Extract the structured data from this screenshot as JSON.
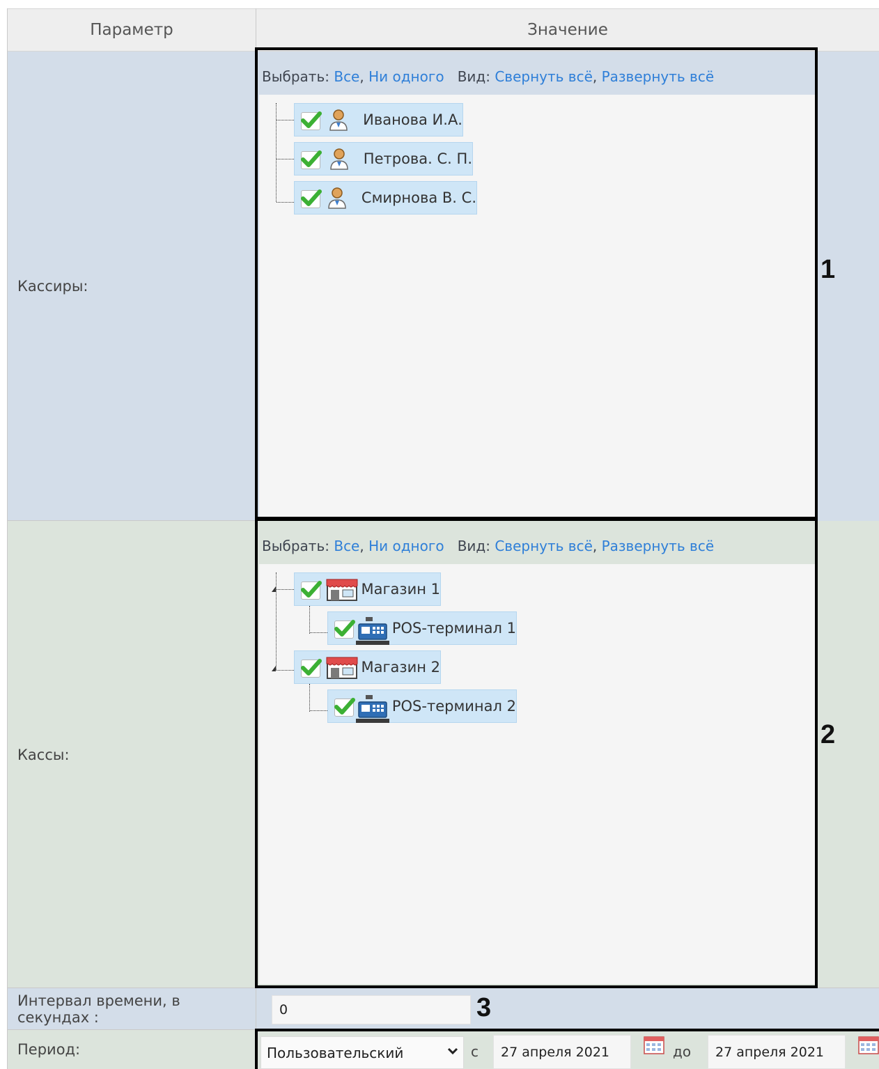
{
  "header": {
    "param_col": "Параметр",
    "value_col": "Значение"
  },
  "rows": {
    "cashiers_label": "Кассиры:",
    "registers_label": "Кассы:",
    "interval_label": "Интервал времени, в секундах :",
    "period_label": "Период:"
  },
  "toolbar": {
    "select_label": "Выбрать:",
    "all": "Все",
    "comma": ",",
    "none": "Ни одного",
    "view_label": "Вид:",
    "collapse": "Свернуть всё",
    "expand": "Развернуть всё"
  },
  "cashiers": [
    {
      "name": "Иванова И.А.",
      "checked": true,
      "icon": "user-icon"
    },
    {
      "name": "Петрова. С. П.",
      "checked": true,
      "icon": "user-icon"
    },
    {
      "name": "Смирнова В. С.",
      "checked": true,
      "icon": "user-icon"
    }
  ],
  "registers": [
    {
      "name": "Магазин 1",
      "checked": true,
      "icon": "store-icon"
    },
    {
      "name": "POS-терминал 1",
      "checked": true,
      "icon": "cash-register-icon"
    },
    {
      "name": "Магазин 2",
      "checked": true,
      "icon": "store-icon"
    },
    {
      "name": "POS-терминал 2",
      "checked": true,
      "icon": "cash-register-icon"
    }
  ],
  "interval": {
    "value": "0"
  },
  "period": {
    "selected": "Пользовательский",
    "from_label": "с",
    "from_date": "27 апреля 2021",
    "to_label": "до",
    "to_date": "27 апреля 2021"
  },
  "callouts": {
    "one": "1",
    "two": "2",
    "three": "3"
  },
  "colors": {
    "link": "#2f7fd8",
    "row_blue": "#d3dde9",
    "row_green": "#dce4dc",
    "node_bg": "#cfe6f7",
    "check_green": "#3cb034"
  }
}
